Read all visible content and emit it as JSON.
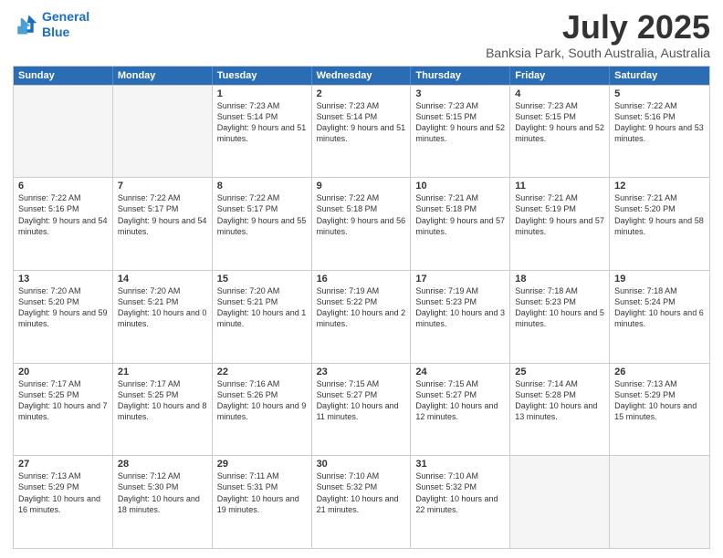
{
  "header": {
    "logo_line1": "General",
    "logo_line2": "Blue",
    "title": "July 2025",
    "subtitle": "Banksia Park, South Australia, Australia"
  },
  "weekdays": [
    "Sunday",
    "Monday",
    "Tuesday",
    "Wednesday",
    "Thursday",
    "Friday",
    "Saturday"
  ],
  "rows": [
    [
      {
        "day": "",
        "info": "",
        "empty": true
      },
      {
        "day": "",
        "info": "",
        "empty": true
      },
      {
        "day": "1",
        "info": "Sunrise: 7:23 AM\nSunset: 5:14 PM\nDaylight: 9 hours and 51 minutes."
      },
      {
        "day": "2",
        "info": "Sunrise: 7:23 AM\nSunset: 5:14 PM\nDaylight: 9 hours and 51 minutes."
      },
      {
        "day": "3",
        "info": "Sunrise: 7:23 AM\nSunset: 5:15 PM\nDaylight: 9 hours and 52 minutes."
      },
      {
        "day": "4",
        "info": "Sunrise: 7:23 AM\nSunset: 5:15 PM\nDaylight: 9 hours and 52 minutes."
      },
      {
        "day": "5",
        "info": "Sunrise: 7:22 AM\nSunset: 5:16 PM\nDaylight: 9 hours and 53 minutes."
      }
    ],
    [
      {
        "day": "6",
        "info": "Sunrise: 7:22 AM\nSunset: 5:16 PM\nDaylight: 9 hours and 54 minutes."
      },
      {
        "day": "7",
        "info": "Sunrise: 7:22 AM\nSunset: 5:17 PM\nDaylight: 9 hours and 54 minutes."
      },
      {
        "day": "8",
        "info": "Sunrise: 7:22 AM\nSunset: 5:17 PM\nDaylight: 9 hours and 55 minutes."
      },
      {
        "day": "9",
        "info": "Sunrise: 7:22 AM\nSunset: 5:18 PM\nDaylight: 9 hours and 56 minutes."
      },
      {
        "day": "10",
        "info": "Sunrise: 7:21 AM\nSunset: 5:18 PM\nDaylight: 9 hours and 57 minutes."
      },
      {
        "day": "11",
        "info": "Sunrise: 7:21 AM\nSunset: 5:19 PM\nDaylight: 9 hours and 57 minutes."
      },
      {
        "day": "12",
        "info": "Sunrise: 7:21 AM\nSunset: 5:20 PM\nDaylight: 9 hours and 58 minutes."
      }
    ],
    [
      {
        "day": "13",
        "info": "Sunrise: 7:20 AM\nSunset: 5:20 PM\nDaylight: 9 hours and 59 minutes."
      },
      {
        "day": "14",
        "info": "Sunrise: 7:20 AM\nSunset: 5:21 PM\nDaylight: 10 hours and 0 minutes."
      },
      {
        "day": "15",
        "info": "Sunrise: 7:20 AM\nSunset: 5:21 PM\nDaylight: 10 hours and 1 minute."
      },
      {
        "day": "16",
        "info": "Sunrise: 7:19 AM\nSunset: 5:22 PM\nDaylight: 10 hours and 2 minutes."
      },
      {
        "day": "17",
        "info": "Sunrise: 7:19 AM\nSunset: 5:23 PM\nDaylight: 10 hours and 3 minutes."
      },
      {
        "day": "18",
        "info": "Sunrise: 7:18 AM\nSunset: 5:23 PM\nDaylight: 10 hours and 5 minutes."
      },
      {
        "day": "19",
        "info": "Sunrise: 7:18 AM\nSunset: 5:24 PM\nDaylight: 10 hours and 6 minutes."
      }
    ],
    [
      {
        "day": "20",
        "info": "Sunrise: 7:17 AM\nSunset: 5:25 PM\nDaylight: 10 hours and 7 minutes."
      },
      {
        "day": "21",
        "info": "Sunrise: 7:17 AM\nSunset: 5:25 PM\nDaylight: 10 hours and 8 minutes."
      },
      {
        "day": "22",
        "info": "Sunrise: 7:16 AM\nSunset: 5:26 PM\nDaylight: 10 hours and 9 minutes."
      },
      {
        "day": "23",
        "info": "Sunrise: 7:15 AM\nSunset: 5:27 PM\nDaylight: 10 hours and 11 minutes."
      },
      {
        "day": "24",
        "info": "Sunrise: 7:15 AM\nSunset: 5:27 PM\nDaylight: 10 hours and 12 minutes."
      },
      {
        "day": "25",
        "info": "Sunrise: 7:14 AM\nSunset: 5:28 PM\nDaylight: 10 hours and 13 minutes."
      },
      {
        "day": "26",
        "info": "Sunrise: 7:13 AM\nSunset: 5:29 PM\nDaylight: 10 hours and 15 minutes."
      }
    ],
    [
      {
        "day": "27",
        "info": "Sunrise: 7:13 AM\nSunset: 5:29 PM\nDaylight: 10 hours and 16 minutes."
      },
      {
        "day": "28",
        "info": "Sunrise: 7:12 AM\nSunset: 5:30 PM\nDaylight: 10 hours and 18 minutes."
      },
      {
        "day": "29",
        "info": "Sunrise: 7:11 AM\nSunset: 5:31 PM\nDaylight: 10 hours and 19 minutes."
      },
      {
        "day": "30",
        "info": "Sunrise: 7:10 AM\nSunset: 5:32 PM\nDaylight: 10 hours and 21 minutes."
      },
      {
        "day": "31",
        "info": "Sunrise: 7:10 AM\nSunset: 5:32 PM\nDaylight: 10 hours and 22 minutes."
      },
      {
        "day": "",
        "info": "",
        "empty": true
      },
      {
        "day": "",
        "info": "",
        "empty": true
      }
    ]
  ]
}
